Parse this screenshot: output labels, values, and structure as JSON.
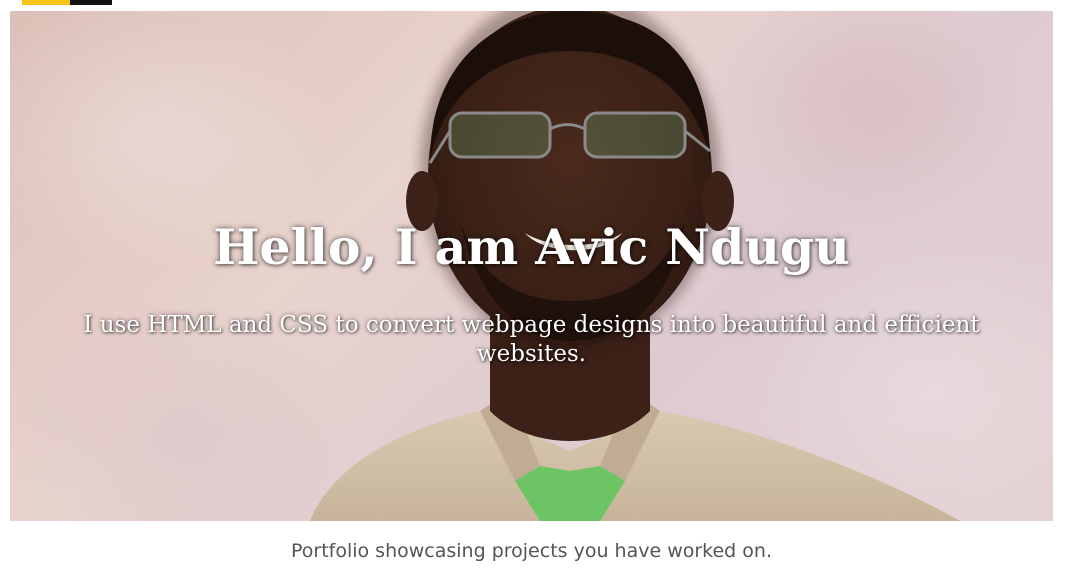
{
  "logo": {
    "name": "site-logo",
    "colors": [
      "#f5c518",
      "#111111"
    ]
  },
  "hero": {
    "headline": "Hello, I am Avic Ndugu",
    "subheadline": "I use HTML and CSS to convert webpage designs into beautiful and efficient websites.",
    "image": "portrait-photo"
  },
  "caption": "Portfolio showcasing projects you have worked on.",
  "colors": {
    "background": "#ffffff",
    "hero_tint": "#e3cfc9",
    "text_light": "#ffffff",
    "caption_text": "#555555"
  }
}
